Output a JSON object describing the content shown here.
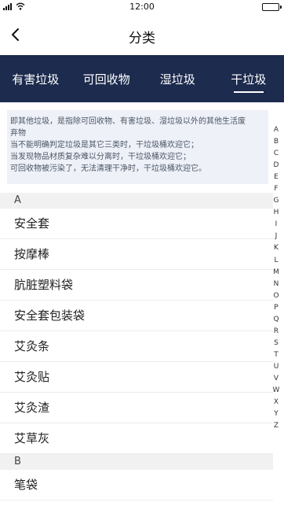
{
  "status": {
    "time": "12:00"
  },
  "nav": {
    "title": "分类",
    "back_icon": "chevron-left-icon"
  },
  "tabs": [
    {
      "label": "有害垃圾",
      "active": false
    },
    {
      "label": "可回收物",
      "active": false
    },
    {
      "label": "湿垃圾",
      "active": false
    },
    {
      "label": "干垃圾",
      "active": true
    }
  ],
  "description": {
    "lines": [
      "即其他垃圾，是指除可回收物、有害垃圾、湿垃圾以外的其他生活废",
      "弃物",
      "当不能明确判定垃圾是其它三类时，干垃圾桶欢迎它；",
      "当发现物品材质复杂难以分离时，干垃圾桶欢迎它；",
      "可回收物被污染了，无法清理干净时，干垃圾桶欢迎它。"
    ]
  },
  "sections": [
    {
      "letter": "A",
      "items": [
        "安全套",
        "按摩棒",
        "肮脏塑料袋",
        "安全套包装袋",
        "艾灸条",
        "艾灸贴",
        "艾灸渣",
        "艾草灰"
      ]
    },
    {
      "letter": "B",
      "items": [
        "笔袋"
      ]
    }
  ],
  "alphabet": [
    "A",
    "B",
    "C",
    "D",
    "E",
    "F",
    "G",
    "H",
    "I",
    "J",
    "K",
    "L",
    "M",
    "N",
    "O",
    "P",
    "Q",
    "R",
    "S",
    "T",
    "U",
    "V",
    "W",
    "X",
    "Y",
    "Z"
  ],
  "colors": {
    "tab_bar_bg": "#1c2b4e",
    "desc_bg": "#eef1f7",
    "section_bg": "#f1f1f1"
  }
}
